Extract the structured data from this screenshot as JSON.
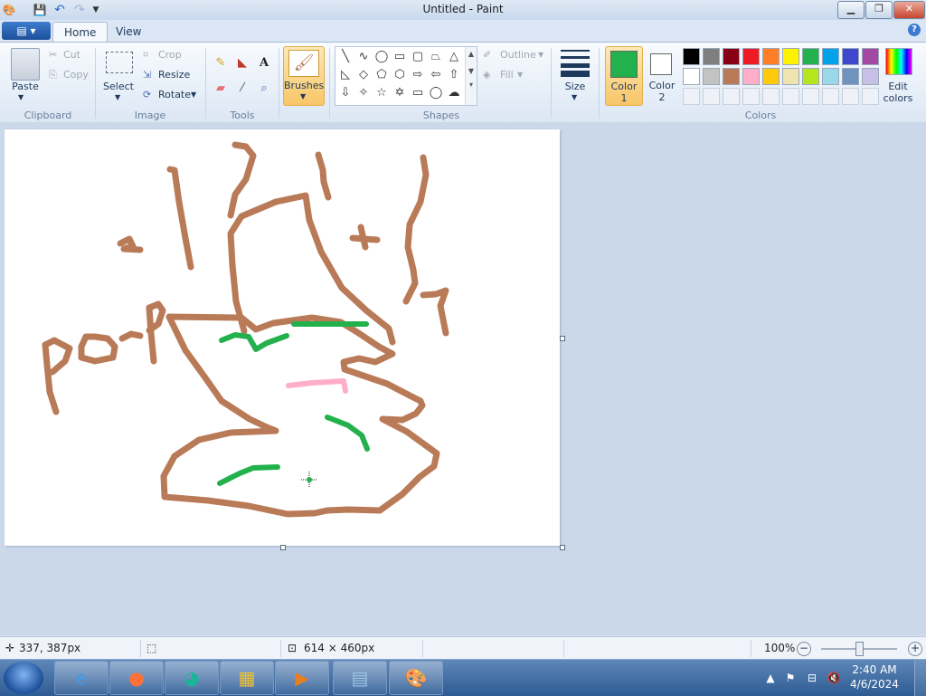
{
  "window": {
    "title": "Untitled - Paint",
    "controls": {
      "minimize": "▁",
      "maximize": "❐",
      "close": "✕"
    }
  },
  "quick_access": {
    "save_icon": "save-icon",
    "undo_icon": "undo-icon",
    "redo_icon": "redo-icon",
    "customize_icon": "dropdown-icon"
  },
  "tabs": {
    "app_menu": "▤ ▾",
    "home": "Home",
    "view": "View"
  },
  "ribbon": {
    "clipboard": {
      "paste": "Paste",
      "cut": "Cut",
      "copy": "Copy",
      "label": "Clipboard"
    },
    "image": {
      "select": "Select",
      "crop": "Crop",
      "resize": "Resize",
      "rotate": "Rotate",
      "label": "Image"
    },
    "tools": {
      "label": "Tools"
    },
    "brushes": {
      "label": "Brushes"
    },
    "shapes": {
      "outline": "Outline",
      "fill": "Fill",
      "label": "Shapes"
    },
    "size": {
      "label": "Size"
    },
    "colors": {
      "color1": "Color",
      "color1_num": "1",
      "color2": "Color",
      "color2_num": "2",
      "edit": "Edit",
      "edit2": "colors",
      "label": "Colors",
      "color1_value": "#22b14c",
      "color2_value": "#ffffff",
      "palette_row1": [
        "#000000",
        "#7f7f7f",
        "#880015",
        "#ed1c24",
        "#ff7f27",
        "#fff200",
        "#22b14c",
        "#00a2e8",
        "#3f48cc",
        "#a349a4"
      ],
      "palette_row2": [
        "#ffffff",
        "#c3c3c3",
        "#b97a57",
        "#ffaec9",
        "#ffc90e",
        "#efe4b0",
        "#b5e61d",
        "#99d9ea",
        "#7092be",
        "#c8bfe7"
      ]
    }
  },
  "canvas": {
    "handwritten_text": "poop",
    "stroke_colors": {
      "brown": "#b97a57",
      "green": "#22b14c",
      "pink": "#ffaec9"
    }
  },
  "status": {
    "cursor_pos": "337, 387px",
    "image_size": "614 × 460px",
    "zoom": "100%"
  },
  "taskbar": {
    "time": "2:40 AM",
    "date": "4/6/2024"
  }
}
